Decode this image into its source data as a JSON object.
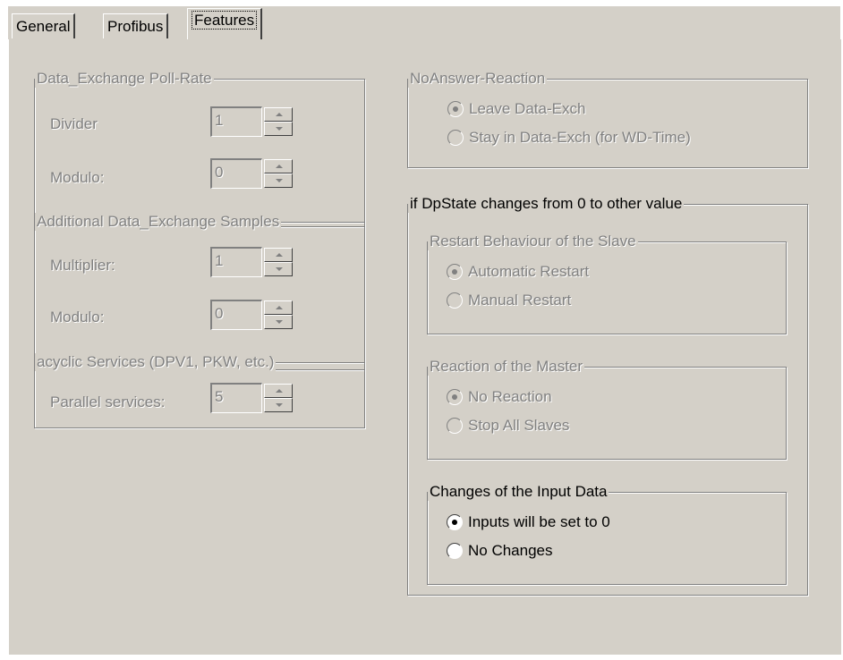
{
  "tabs": [
    "General",
    "Profibus",
    "Features"
  ],
  "poll_rate": {
    "title": "Data_Exchange Poll-Rate",
    "divider_label": "Divider",
    "divider_value": "1",
    "modulo_label": "Modulo:",
    "modulo_value": "0"
  },
  "samples": {
    "title": "Additional Data_Exchange Samples",
    "multiplier_label": "Multiplier:",
    "multiplier_value": "1",
    "modulo_label": "Modulo:",
    "modulo_value": "0"
  },
  "acyclic": {
    "title": "acyclic Services (DPV1, PKW, etc.)",
    "parallel_label": "Parallel services:",
    "parallel_value": "5"
  },
  "noanswer": {
    "title": "NoAnswer-Reaction",
    "options": [
      "Leave Data-Exch",
      "Stay in Data-Exch (for WD-Time)"
    ],
    "selected": 0
  },
  "dpstate": {
    "title": "if DpState changes from 0 to other value",
    "restart": {
      "title": "Restart Behaviour of the Slave",
      "options": [
        "Automatic Restart",
        "Manual Restart"
      ],
      "selected": 0
    },
    "master": {
      "title": "Reaction of the Master",
      "options": [
        "No Reaction",
        "Stop All Slaves"
      ],
      "selected": 0
    },
    "input": {
      "title": "Changes of the Input Data",
      "options": [
        "Inputs will be set to 0",
        "No Changes"
      ],
      "selected": 0
    }
  }
}
